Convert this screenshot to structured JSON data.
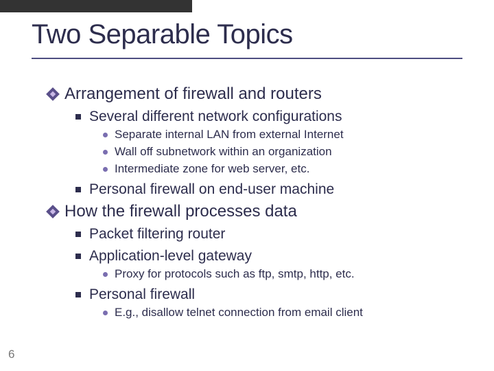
{
  "page_number": "6",
  "title": "Two Separable Topics",
  "bullets": {
    "l1_0": "Arrangement of firewall and routers",
    "l2_0": "Several different network configurations",
    "l3_0": "Separate internal LAN from external Internet",
    "l3_1": "Wall off subnetwork within an organization",
    "l3_2": "Intermediate zone for web server, etc.",
    "l2_1": "Personal firewall on end-user machine",
    "l1_1": "How the firewall processes data",
    "l2_2": "Packet filtering router",
    "l2_3": "Application-level gateway",
    "l3_3": "Proxy for protocols such as ftp, smtp, http, etc.",
    "l2_4": "Personal firewall",
    "l3_4": "E.g., disallow telnet connection from email client"
  }
}
